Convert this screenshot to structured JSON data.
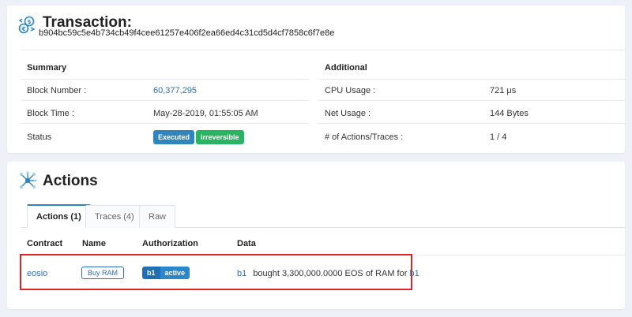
{
  "transaction": {
    "title": "Transaction:",
    "hash": "b904bc59c5e4b734cb49f4cee61257e406f2ea66ed4c31cd5d4cf7858c6f7e8e",
    "summary": {
      "heading": "Summary",
      "block_number_label": "Block Number :",
      "block_number": "60,377,295",
      "block_time_label": "Block Time :",
      "block_time": "May-28-2019, 01:55:05 AM",
      "status_label": "Status",
      "status_executed": "Executed",
      "status_irreversible": "irreversible"
    },
    "additional": {
      "heading": "Additional",
      "cpu_label": "CPU Usage :",
      "cpu_value": "721 μs",
      "net_label": "Net Usage :",
      "net_value": "144 Bytes",
      "actions_label": "# of Actions/Traces :",
      "actions_value": "1 / 4"
    }
  },
  "actions": {
    "title": "Actions",
    "tabs": [
      {
        "label": "Actions (1)",
        "active": true
      },
      {
        "label": "Traces (4)",
        "active": false
      },
      {
        "label": "Raw",
        "active": false
      }
    ],
    "columns": {
      "contract": "Contract",
      "name": "Name",
      "authorization": "Authorization",
      "data": "Data"
    },
    "rows": [
      {
        "contract": "eosio",
        "name": "Buy RAM",
        "auth_actor": "b1",
        "auth_permission": "active",
        "data_from": "b1",
        "data_text": "bought 3,300,000.0000 EOS of RAM for",
        "data_to": "b1"
      }
    ]
  },
  "icons": {
    "transaction": "transaction-exchange-icon",
    "actions": "network-nodes-icon"
  },
  "colors": {
    "executed_badge": "#2e86c1",
    "irreversible_badge": "#28b463",
    "link": "#2e6db4",
    "highlight_box": "#e02424",
    "tab_active_border": "#2e86c1"
  }
}
